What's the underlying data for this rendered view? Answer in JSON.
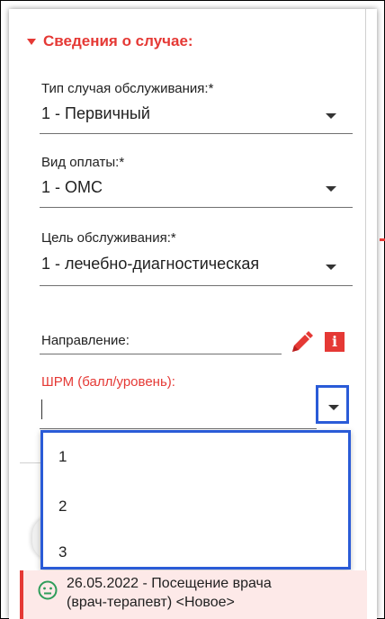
{
  "case_section": {
    "title": "Сведения о случае:",
    "service_type": {
      "label": "Тип случая обслуживания:*",
      "value": "1 - Первичный"
    },
    "payment_type": {
      "label": "Вид оплаты:*",
      "value": "1 - ОМС"
    },
    "service_goal": {
      "label": "Цель обслуживания:*",
      "value": "1 - лечебно-диагностическая"
    },
    "referral": {
      "label": "Направление:",
      "info_icon": "i"
    },
    "shrm": {
      "label": "ШРМ (балл/уровень):",
      "value": "",
      "options": [
        "1",
        "2",
        "3"
      ]
    }
  },
  "event": {
    "line1": "26.05.2022 - Посещение врача",
    "line2": "(врач-терапевт)  <Новое>"
  },
  "colors": {
    "accent_red": "#e53935",
    "focus_blue": "#2a5bd7",
    "smiley_green": "#2e9d5a"
  }
}
